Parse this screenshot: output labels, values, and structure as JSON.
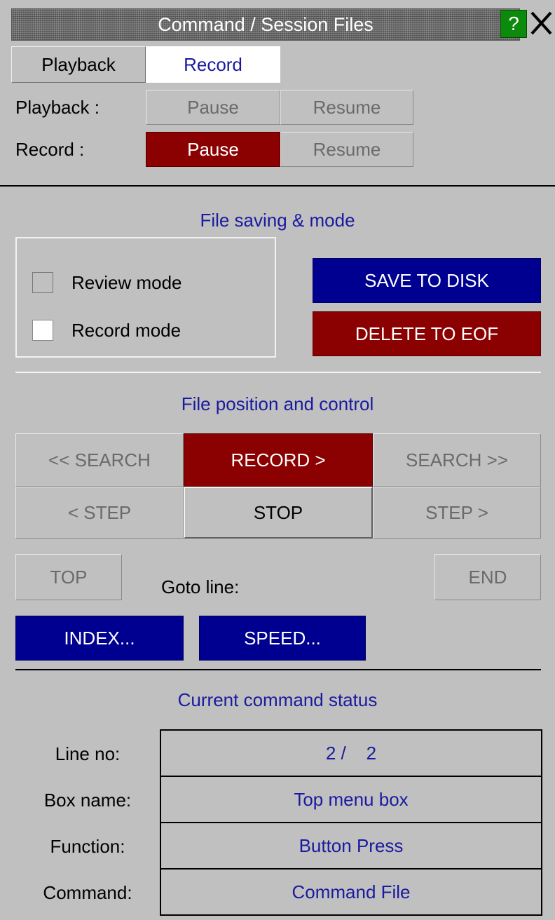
{
  "window": {
    "title": "Command / Session Files",
    "help_label": "?"
  },
  "tabs": [
    {
      "label": "Playback",
      "active": false
    },
    {
      "label": "Record",
      "active": true
    }
  ],
  "playback_row": {
    "label": "Playback :",
    "pause": "Pause",
    "resume": "Resume"
  },
  "record_row": {
    "label": "Record :",
    "pause": "Pause",
    "resume": "Resume"
  },
  "file_saving": {
    "heading": "File saving & mode",
    "review_mode": {
      "label": "Review mode",
      "checked": false
    },
    "record_mode": {
      "label": "Record mode",
      "checked": false
    },
    "save_button": "SAVE TO DISK",
    "delete_button": "DELETE TO EOF"
  },
  "file_position": {
    "heading": "File position and control",
    "search_back": "<< SEARCH",
    "record": "RECORD  >",
    "search_fwd": "SEARCH  >>",
    "step_back": "<  STEP",
    "stop": "STOP",
    "step_fwd": "STEP  >",
    "top": "TOP",
    "goto_label": "Goto line:",
    "end": "END",
    "index": "INDEX...",
    "speed": "SPEED..."
  },
  "status": {
    "heading": "Current command status",
    "rows": [
      {
        "label": "Line no:",
        "value": "2 /    2"
      },
      {
        "label": "Box name:",
        "value": "Top menu box"
      },
      {
        "label": "Function:",
        "value": "Button Press"
      },
      {
        "label": "Command:",
        "value": "Command File"
      }
    ]
  },
  "colors": {
    "background": "#c0c0c0",
    "accent_red": "#8b0000",
    "accent_blue": "#000090",
    "help_green": "#0b8a0b",
    "heading_text": "#1a1aa0"
  }
}
